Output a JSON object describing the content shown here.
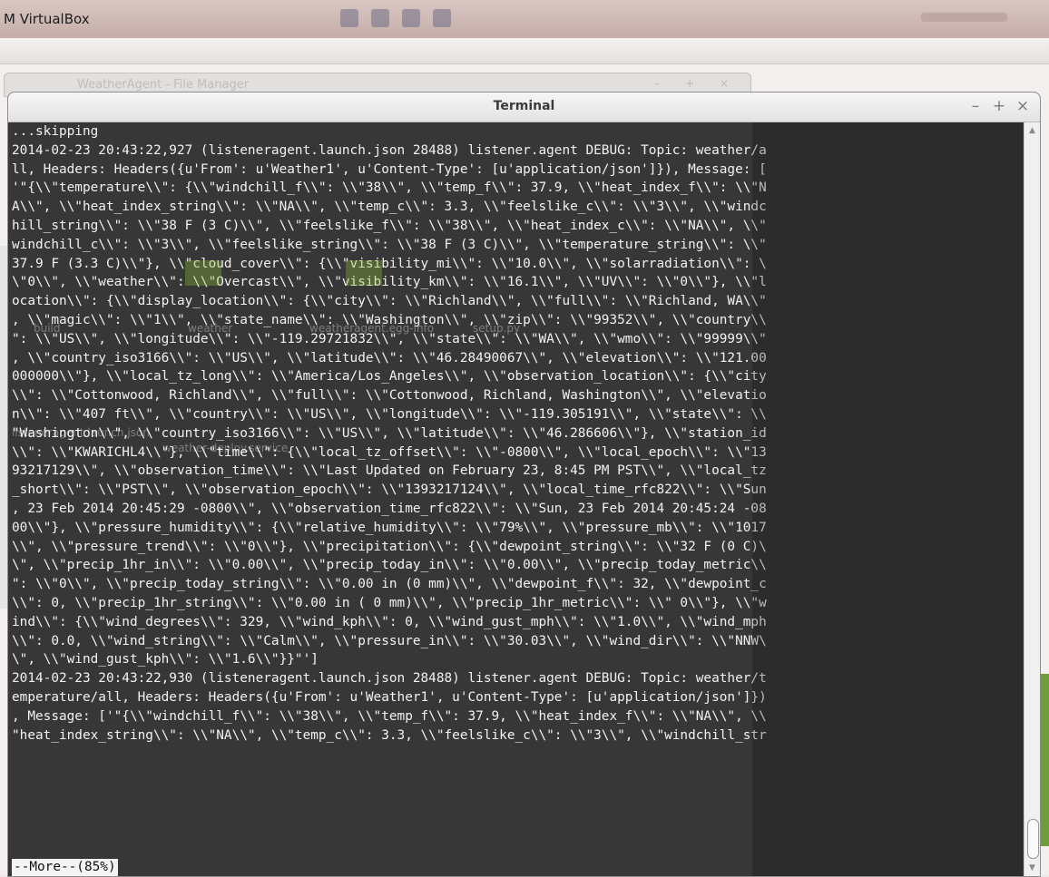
{
  "virtualbox": {
    "title": "M VirtualBox"
  },
  "file_manager": {
    "title": "WeatherAgent - File Manager",
    "controls": "– + ×"
  },
  "terminal": {
    "title": "Terminal",
    "controls": {
      "minimize": "–",
      "maximize": "+",
      "close": "×"
    },
    "lines": [
      "...skipping",
      "2014-02-23 20:43:22,927 (listeneragent.launch.json 28488) listener.agent DEBUG: Topic: weather/a",
      "ll, Headers: Headers({u'From': u'Weather1', u'Content-Type': [u'application/json']}), Message: [",
      "'\"{\\\\\"temperature\\\\\": {\\\\\"windchill_f\\\\\": \\\\\"38\\\\\", \\\\\"temp_f\\\\\": 37.9, \\\\\"heat_index_f\\\\\": \\\\\"N",
      "A\\\\\", \\\\\"heat_index_string\\\\\": \\\\\"NA\\\\\", \\\\\"temp_c\\\\\": 3.3, \\\\\"feelslike_c\\\\\": \\\\\"3\\\\\", \\\\\"windc",
      "hill_string\\\\\": \\\\\"38 F (3 C)\\\\\", \\\\\"feelslike_f\\\\\": \\\\\"38\\\\\", \\\\\"heat_index_c\\\\\": \\\\\"NA\\\\\", \\\\\"",
      "windchill_c\\\\\": \\\\\"3\\\\\", \\\\\"feelslike_string\\\\\": \\\\\"38 F (3 C)\\\\\", \\\\\"temperature_string\\\\\": \\\\\"",
      "37.9 F (3.3 C)\\\\\"}, \\\\\"cloud_cover\\\\\": {\\\\\"visibility_mi\\\\\": \\\\\"10.0\\\\\", \\\\\"solarradiation\\\\\": \\",
      "\\\"0\\\\\", \\\\\"weather\\\\\": \\\\\"Overcast\\\\\", \\\\\"visibility_km\\\\\": \\\\\"16.1\\\\\", \\\\\"UV\\\\\": \\\\\"0\\\\\"}, \\\\\"l",
      "ocation\\\\\": {\\\\\"display_location\\\\\": {\\\\\"city\\\\\": \\\\\"Richland\\\\\", \\\\\"full\\\\\": \\\\\"Richland, WA\\\\\"",
      ", \\\\\"magic\\\\\": \\\\\"1\\\\\", \\\\\"state_name\\\\\": \\\\\"Washington\\\\\", \\\\\"zip\\\\\": \\\\\"99352\\\\\", \\\\\"country\\\\",
      "\": \\\\\"US\\\\\", \\\\\"longitude\\\\\": \\\\\"-119.29721832\\\\\", \\\\\"state\\\\\": \\\\\"WA\\\\\", \\\\\"wmo\\\\\": \\\\\"99999\\\\\"",
      ", \\\\\"country_iso3166\\\\\": \\\\\"US\\\\\", \\\\\"latitude\\\\\": \\\\\"46.28490067\\\\\", \\\\\"elevation\\\\\": \\\\\"121.00",
      "000000\\\\\"}, \\\\\"local_tz_long\\\\\": \\\\\"America/Los_Angeles\\\\\", \\\\\"observation_location\\\\\": {\\\\\"city",
      "\\\\\": \\\\\"Cottonwood, Richland\\\\\", \\\\\"full\\\\\": \\\\\"Cottonwood, Richland, Washington\\\\\", \\\\\"elevatio",
      "n\\\\\": \\\\\"407 ft\\\\\", \\\\\"country\\\\\": \\\\\"US\\\\\", \\\\\"longitude\\\\\": \\\\\"-119.305191\\\\\", \\\\\"state\\\\\": \\\\",
      "\"Washington\\\\\", \\\\\"country_iso3166\\\\\": \\\\\"US\\\\\", \\\\\"latitude\\\\\": \\\\\"46.286606\\\\\"}, \\\\\"station_id",
      "\\\\\": \\\\\"KWARICHL4\\\\\"}, \\\\\"time\\\\\": {\\\\\"local_tz_offset\\\\\": \\\\\"-0800\\\\\", \\\\\"local_epoch\\\\\": \\\\\"13",
      "93217129\\\\\", \\\\\"observation_time\\\\\": \\\\\"Last Updated on February 23, 8:45 PM PST\\\\\", \\\\\"local_tz",
      "_short\\\\\": \\\\\"PST\\\\\", \\\\\"observation_epoch\\\\\": \\\\\"1393217124\\\\\", \\\\\"local_time_rfc822\\\\\": \\\\\"Sun",
      ", 23 Feb 2014 20:45:29 -0800\\\\\", \\\\\"observation_time_rfc822\\\\\": \\\\\"Sun, 23 Feb 2014 20:45:24 -08",
      "00\\\\\"}, \\\\\"pressure_humidity\\\\\": {\\\\\"relative_humidity\\\\\": \\\\\"79%\\\\\", \\\\\"pressure_mb\\\\\": \\\\\"1017",
      "\\\\\", \\\\\"pressure_trend\\\\\": \\\\\"0\\\\\"}, \\\\\"precipitation\\\\\": {\\\\\"dewpoint_string\\\\\": \\\\\"32 F (0 C)\\",
      "\\\", \\\\\"precip_1hr_in\\\\\": \\\\\"0.00\\\\\", \\\\\"precip_today_in\\\\\": \\\\\"0.00\\\\\", \\\\\"precip_today_metric\\\\",
      "\": \\\\\"0\\\\\", \\\\\"precip_today_string\\\\\": \\\\\"0.00 in (0 mm)\\\\\", \\\\\"dewpoint_f\\\\\": 32, \\\\\"dewpoint_c",
      "\\\\\": 0, \\\\\"precip_1hr_string\\\\\": \\\\\"0.00 in ( 0 mm)\\\\\", \\\\\"precip_1hr_metric\\\\\": \\\\\" 0\\\\\"}, \\\\\"w",
      "ind\\\\\": {\\\\\"wind_degrees\\\\\": 329, \\\\\"wind_kph\\\\\": 0, \\\\\"wind_gust_mph\\\\\": \\\\\"1.0\\\\\", \\\\\"wind_mph",
      "\\\\\": 0.0, \\\\\"wind_string\\\\\": \\\\\"Calm\\\\\", \\\\\"pressure_in\\\\\": \\\\\"30.03\\\\\", \\\\\"wind_dir\\\\\": \\\\\"NNW\\",
      "\\\", \\\\\"wind_gust_kph\\\\\": \\\\\"1.6\\\\\"}}\"']",
      "2014-02-23 20:43:22,930 (listeneragent.launch.json 28488) listener.agent DEBUG: Topic: weather/t",
      "emperature/all, Headers: Headers({u'From': u'Weather1', u'Content-Type': [u'application/json']})",
      ", Message: ['\"{\\\\\"windchill_f\\\\\": \\\\\"38\\\\\", \\\\\"temp_f\\\\\": 37.9, \\\\\"heat_index_f\\\\\": \\\\\"NA\\\\\", \\\\",
      "\"heat_index_string\\\\\": \\\\\"NA\\\\\", \\\\\"temp_c\\\\\": 3.3, \\\\\"feelslike_c\\\\\": \\\\\"3\\\\\", \\\\\"windchill_str"
    ],
    "pager_prompt": "--More--(85%)"
  },
  "desktop_icons": [
    "build",
    "weather",
    "weatheragent.egg-info",
    "setup.py",
    "listeneragent.launch.json",
    "weather-deploy.service"
  ]
}
